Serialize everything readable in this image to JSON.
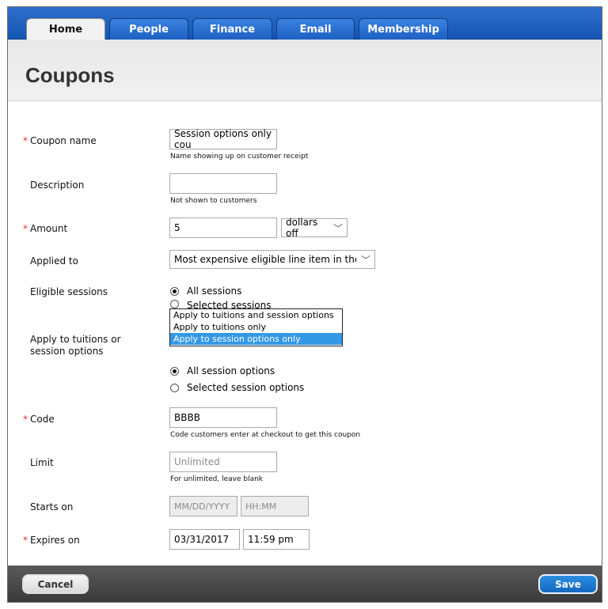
{
  "nav": {
    "tabs": [
      {
        "label": "Home",
        "active": true
      },
      {
        "label": "People",
        "active": false
      },
      {
        "label": "Finance",
        "active": false
      },
      {
        "label": "Email",
        "active": false
      },
      {
        "label": "Membership",
        "active": false
      }
    ]
  },
  "page": {
    "title": "Coupons"
  },
  "form": {
    "required_marker": "*",
    "coupon_name": {
      "label": "Coupon name",
      "value": "Session options only cou",
      "help": "Name showing up on customer receipt"
    },
    "description": {
      "label": "Description",
      "value": "",
      "help": "Not shown to customers"
    },
    "amount": {
      "label": "Amount",
      "value": "5",
      "unit": "dollars off"
    },
    "applied_to": {
      "label": "Applied to",
      "value": "Most expensive eligible line item in the order"
    },
    "eligible_sessions": {
      "label": "Eligible sessions",
      "options": [
        "All sessions",
        "Selected sessions"
      ],
      "selected": "All sessions"
    },
    "apply_to": {
      "label": "Apply to tuitions or session options",
      "dropdown_options": [
        "Apply to tuitions and session options",
        "Apply to tuitions only",
        "Apply to session options only"
      ],
      "selected": "Apply to session options only"
    },
    "session_options": {
      "options": [
        "All session options",
        "Selected session options"
      ],
      "selected": "All session options"
    },
    "code": {
      "label": "Code",
      "value": "BBBB",
      "help": "Code customers enter at checkout to get this coupon"
    },
    "limit": {
      "label": "Limit",
      "placeholder": "Unlimited",
      "help": "For unlimited, leave blank"
    },
    "starts_on": {
      "label": "Starts on",
      "date_placeholder": "MM/DD/YYYY",
      "time_placeholder": "HH:MM"
    },
    "expires_on": {
      "label": "Expires on",
      "date": "03/31/2017",
      "time": "11:59 pm"
    }
  },
  "footer": {
    "cancel_label": "Cancel",
    "save_label": "Save"
  },
  "colors": {
    "nav_blue": "#1e63c4",
    "required_red": "#dd3333",
    "selection_blue": "#3399e6",
    "save_blue": "#1c7ad4"
  }
}
